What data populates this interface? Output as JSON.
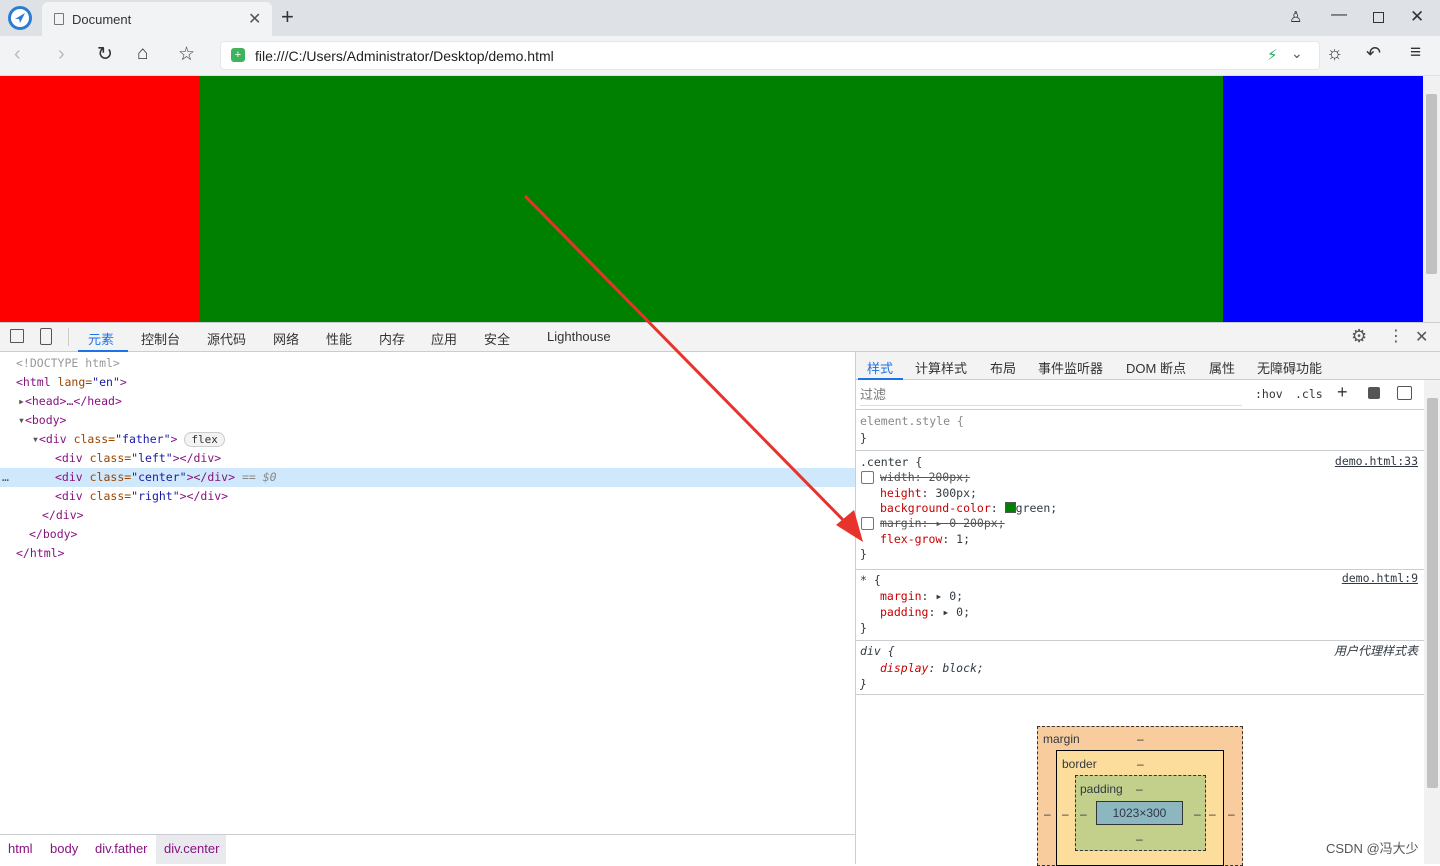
{
  "browser": {
    "tab_title": "Document",
    "url": "file:///C:/Users/Administrator/Desktop/demo.html"
  },
  "page": {
    "boxes": [
      {
        "name": "left",
        "color": "#ff0000"
      },
      {
        "name": "center",
        "color": "#008000"
      },
      {
        "name": "right",
        "color": "#0000ff"
      }
    ]
  },
  "devtools": {
    "tabs": [
      "元素",
      "控制台",
      "源代码",
      "网络",
      "性能",
      "内存",
      "应用",
      "安全",
      "Lighthouse"
    ],
    "dom_lines": {
      "l0": "<!DOCTYPE html>",
      "l1_tag": "<html",
      "l1_attr": " lang=",
      "l1_val": "\"en\"",
      "l1_end": ">",
      "l2": "<head>…</head>",
      "l3": "<body>",
      "l4_tag": "<div",
      "l4_attr": " class=",
      "l4_val": "\"father\"",
      "l4_end": ">",
      "l4_badge": "flex",
      "l5_tag": "<div",
      "l5_attr": " class=",
      "l5_val": "\"left\"",
      "l5_end": "></div>",
      "l6_tag": "<div",
      "l6_attr": " class=",
      "l6_val": "\"center\"",
      "l6_end": "></div>",
      "l6_sel": " == $0",
      "l6_dots": "…",
      "l7_tag": "<div",
      "l7_attr": " class=",
      "l7_val": "\"right\"",
      "l7_end": "></div>",
      "l8": "</div>",
      "l9": "</body>",
      "l10": "</html>"
    },
    "breadcrumbs": [
      "html",
      "body",
      "div.father",
      "div.center"
    ],
    "styles_tabs": [
      "样式",
      "计算样式",
      "布局",
      "事件监听器",
      "DOM 断点",
      "属性",
      "无障碍功能"
    ],
    "filter_placeholder": "过滤",
    "hov": ":hov",
    "cls": ".cls",
    "rules": {
      "element_style": "element.style {",
      "close": "}",
      "center_selector": ".center {",
      "center_src": "demo.html:33",
      "center_width": "width: 200px;",
      "center_height_p": "height",
      "center_height_v": ": 300px;",
      "center_bg_p": "background-color",
      "center_bg_v": "green;",
      "center_margin": "margin: ▸ 0 200px;",
      "center_flex_p": "flex-grow",
      "center_flex_v": ": 1;",
      "star_selector": "* {",
      "star_src": "demo.html:9",
      "star_margin_p": "margin",
      "star_margin_v": ": ▸ 0;",
      "star_padding_p": "padding",
      "star_padding_v": ": ▸ 0;",
      "div_selector": "div {",
      "div_src": "用户代理样式表",
      "div_display_p": "display",
      "div_display_v": ": block;"
    },
    "box_model": {
      "margin": "margin",
      "border": "border",
      "padding": "padding",
      "dash": "–",
      "content": "1023×300"
    }
  },
  "watermark": "CSDN @冯大少"
}
